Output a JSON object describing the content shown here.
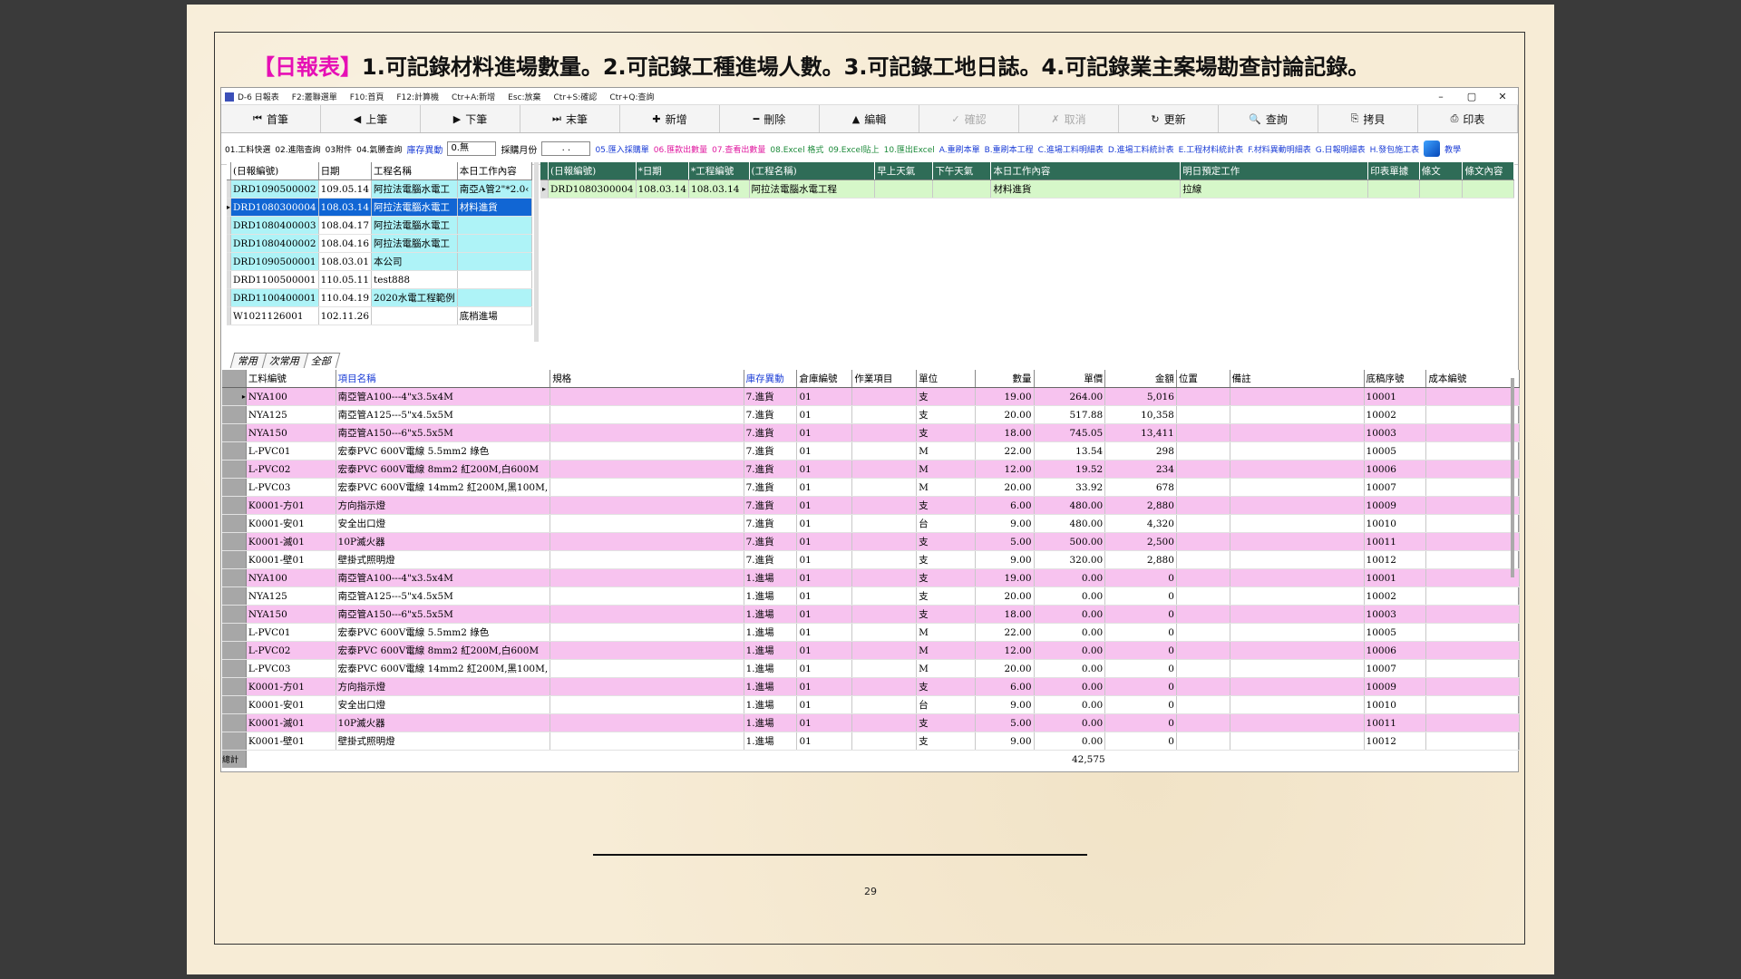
{
  "heading": {
    "tag": "【日報表】",
    "text": "1.可記錄材料進場數量。2.可記錄工種進場人數。3.可記錄工地日誌。4.可記錄業主案場勘查討論記錄。"
  },
  "titlebar": {
    "app_title": "D-6 日報表",
    "shortcuts": [
      "F2:叢聯選單",
      "F10:首頁",
      "F12:計算機",
      "Ctr+A:新增",
      "Esc:放棄",
      "Ctr+S:確認",
      "Ctr+Q:查詢"
    ],
    "min": "–",
    "max": "▢",
    "close": "✕"
  },
  "toolbar": [
    {
      "label": "首筆",
      "icon": "⏮",
      "enabled": true
    },
    {
      "label": "上筆",
      "icon": "◀",
      "enabled": true
    },
    {
      "label": "下筆",
      "icon": "▶",
      "enabled": true
    },
    {
      "label": "末筆",
      "icon": "⏭",
      "enabled": true
    },
    {
      "label": "新增",
      "icon": "✚",
      "enabled": true
    },
    {
      "label": "刪除",
      "icon": "━",
      "enabled": true
    },
    {
      "label": "編輯",
      "icon": "▲",
      "enabled": true
    },
    {
      "label": "確認",
      "icon": "✓",
      "enabled": false
    },
    {
      "label": "取消",
      "icon": "✗",
      "enabled": false
    },
    {
      "label": "更新",
      "icon": "↻",
      "enabled": true
    },
    {
      "label": "查詢",
      "icon": "🔍",
      "enabled": true
    },
    {
      "label": "拷貝",
      "icon": "⎘",
      "enabled": true
    },
    {
      "label": "印表",
      "icon": "⎙",
      "enabled": true
    }
  ],
  "links": {
    "plain": [
      "01.工料快選",
      "02.進階查詢",
      "03附件",
      "04.氣勝查詢"
    ],
    "stock_label": "庫存異動",
    "stock_value": "0.無",
    "month_label": "採購月份",
    "month_value": ". .",
    "blue1": "05.匯入採購單",
    "mag": [
      "06.匯款出數量",
      "07.查看出數量"
    ],
    "green": [
      "08.Excel 格式",
      "09.Excel貼上",
      "10.匯出Excel"
    ],
    "blue": [
      "A.重刷本單",
      "B.重刷本工程",
      "C.進場工料明細表",
      "D.進場工料統計表",
      "E.工程材料統計表",
      "F.材料異動明細表",
      "G.日報明細表",
      "H.發包施工表"
    ],
    "teach": "教學"
  },
  "left_table": {
    "headers": [
      "(日報編號)",
      "日期",
      "工程名稱",
      "本日工作內容"
    ],
    "rows": [
      {
        "id": "DRD1090500002",
        "date": "109.05.14",
        "name": "阿拉法電腦水電工",
        "work": "南亞A管2\"*2.0‹",
        "style": "cyan"
      },
      {
        "id": "DRD1080300004",
        "date": "108.03.14",
        "name": "阿拉法電腦水電工",
        "work": "材料進貨",
        "style": "blue"
      },
      {
        "id": "DRD1080400003",
        "date": "108.04.17",
        "name": "阿拉法電腦水電工",
        "work": "",
        "style": "cyan"
      },
      {
        "id": "DRD1080400002",
        "date": "108.04.16",
        "name": "阿拉法電腦水電工",
        "work": "",
        "style": "cyan"
      },
      {
        "id": "DRD1090500001",
        "date": "108.03.01",
        "name": "本公司",
        "work": "",
        "style": "cyan"
      },
      {
        "id": "DRD1100500001",
        "date": "110.05.11",
        "name": "test888",
        "work": "",
        "style": "plain"
      },
      {
        "id": "DRD1100400001",
        "date": "110.04.19",
        "name": "2020水電工程範例",
        "work": "",
        "style": "cyan"
      },
      {
        "id": "W1021126001",
        "date": "102.11.26",
        "name": "",
        "work": "底梢進場",
        "style": "plain"
      }
    ]
  },
  "right_table": {
    "headers": [
      "(日報編號)",
      "*日期",
      "*工程編號",
      "(工程名稱)",
      "早上天氣",
      "下午天氣",
      "本日工作內容",
      "明日預定工作",
      "印表單據",
      "條文",
      "條文內容"
    ],
    "row": [
      "DRD1080300004",
      "108.03.14",
      "108.03.14",
      "阿拉法電腦水電工程",
      "",
      "",
      "材料進貨",
      "拉線",
      "",
      "",
      ""
    ]
  },
  "tabs": [
    "常用",
    "次常用",
    "全部"
  ],
  "lower_table": {
    "headers": [
      "工料編號",
      "項目名稱",
      "規格",
      "庫存異動",
      "倉庫編號",
      "作業項目",
      "單位",
      "數量",
      "單價",
      "金額",
      "位置",
      "備註",
      "底稿序號",
      "成本編號"
    ],
    "rows": [
      [
        "NYA100",
        "南亞管A100---4\"x3.5x4M",
        "",
        "7.進貨",
        "01",
        "",
        "支",
        "19.00",
        "264.00",
        "5,016",
        "",
        "",
        "10001",
        ""
      ],
      [
        "NYA125",
        "南亞管A125---5\"x4.5x5M",
        "",
        "7.進貨",
        "01",
        "",
        "支",
        "20.00",
        "517.88",
        "10,358",
        "",
        "",
        "10002",
        ""
      ],
      [
        "NYA150",
        "南亞管A150---6\"x5.5x5M",
        "",
        "7.進貨",
        "01",
        "",
        "支",
        "18.00",
        "745.05",
        "13,411",
        "",
        "",
        "10003",
        ""
      ],
      [
        "L-PVC01",
        "宏泰PVC 600V電線 5.5mm2 綠色",
        "",
        "7.進貨",
        "01",
        "",
        "M",
        "22.00",
        "13.54",
        "298",
        "",
        "",
        "10005",
        ""
      ],
      [
        "L-PVC02",
        "宏泰PVC 600V電線 8mm2 紅200M,白600M",
        "",
        "7.進貨",
        "01",
        "",
        "M",
        "12.00",
        "19.52",
        "234",
        "",
        "",
        "10006",
        ""
      ],
      [
        "L-PVC03",
        "宏泰PVC 600V電線 14mm2 紅200M,黑100M,",
        "",
        "7.進貨",
        "01",
        "",
        "M",
        "20.00",
        "33.92",
        "678",
        "",
        "",
        "10007",
        ""
      ],
      [
        "K0001-方01",
        "方向指示燈",
        "",
        "7.進貨",
        "01",
        "",
        "支",
        "6.00",
        "480.00",
        "2,880",
        "",
        "",
        "10009",
        ""
      ],
      [
        "K0001-安01",
        "安全出口燈",
        "",
        "7.進貨",
        "01",
        "",
        "台",
        "9.00",
        "480.00",
        "4,320",
        "",
        "",
        "10010",
        ""
      ],
      [
        "K0001-滅01",
        "10P滅火器",
        "",
        "7.進貨",
        "01",
        "",
        "支",
        "5.00",
        "500.00",
        "2,500",
        "",
        "",
        "10011",
        ""
      ],
      [
        "K0001-壁01",
        "壁掛式照明燈",
        "",
        "7.進貨",
        "01",
        "",
        "支",
        "9.00",
        "320.00",
        "2,880",
        "",
        "",
        "10012",
        ""
      ],
      [
        "NYA100",
        "南亞管A100---4\"x3.5x4M",
        "",
        "1.進場",
        "01",
        "",
        "支",
        "19.00",
        "0.00",
        "0",
        "",
        "",
        "10001",
        ""
      ],
      [
        "NYA125",
        "南亞管A125---5\"x4.5x5M",
        "",
        "1.進場",
        "01",
        "",
        "支",
        "20.00",
        "0.00",
        "0",
        "",
        "",
        "10002",
        ""
      ],
      [
        "NYA150",
        "南亞管A150---6\"x5.5x5M",
        "",
        "1.進場",
        "01",
        "",
        "支",
        "18.00",
        "0.00",
        "0",
        "",
        "",
        "10003",
        ""
      ],
      [
        "L-PVC01",
        "宏泰PVC 600V電線 5.5mm2 綠色",
        "",
        "1.進場",
        "01",
        "",
        "M",
        "22.00",
        "0.00",
        "0",
        "",
        "",
        "10005",
        ""
      ],
      [
        "L-PVC02",
        "宏泰PVC 600V電線 8mm2 紅200M,白600M",
        "",
        "1.進場",
        "01",
        "",
        "M",
        "12.00",
        "0.00",
        "0",
        "",
        "",
        "10006",
        ""
      ],
      [
        "L-PVC03",
        "宏泰PVC 600V電線 14mm2 紅200M,黑100M,",
        "",
        "1.進場",
        "01",
        "",
        "M",
        "20.00",
        "0.00",
        "0",
        "",
        "",
        "10007",
        ""
      ],
      [
        "K0001-方01",
        "方向指示燈",
        "",
        "1.進場",
        "01",
        "",
        "支",
        "6.00",
        "0.00",
        "0",
        "",
        "",
        "10009",
        ""
      ],
      [
        "K0001-安01",
        "安全出口燈",
        "",
        "1.進場",
        "01",
        "",
        "台",
        "9.00",
        "0.00",
        "0",
        "",
        "",
        "10010",
        ""
      ],
      [
        "K0001-滅01",
        "10P滅火器",
        "",
        "1.進場",
        "01",
        "",
        "支",
        "5.00",
        "0.00",
        "0",
        "",
        "",
        "10011",
        ""
      ],
      [
        "K0001-壁01",
        "壁掛式照明燈",
        "",
        "1.進場",
        "01",
        "",
        "支",
        "9.00",
        "0.00",
        "0",
        "",
        "",
        "10012",
        ""
      ]
    ],
    "total_label": "總計",
    "total_amount": "42,575"
  },
  "page_number": "29"
}
